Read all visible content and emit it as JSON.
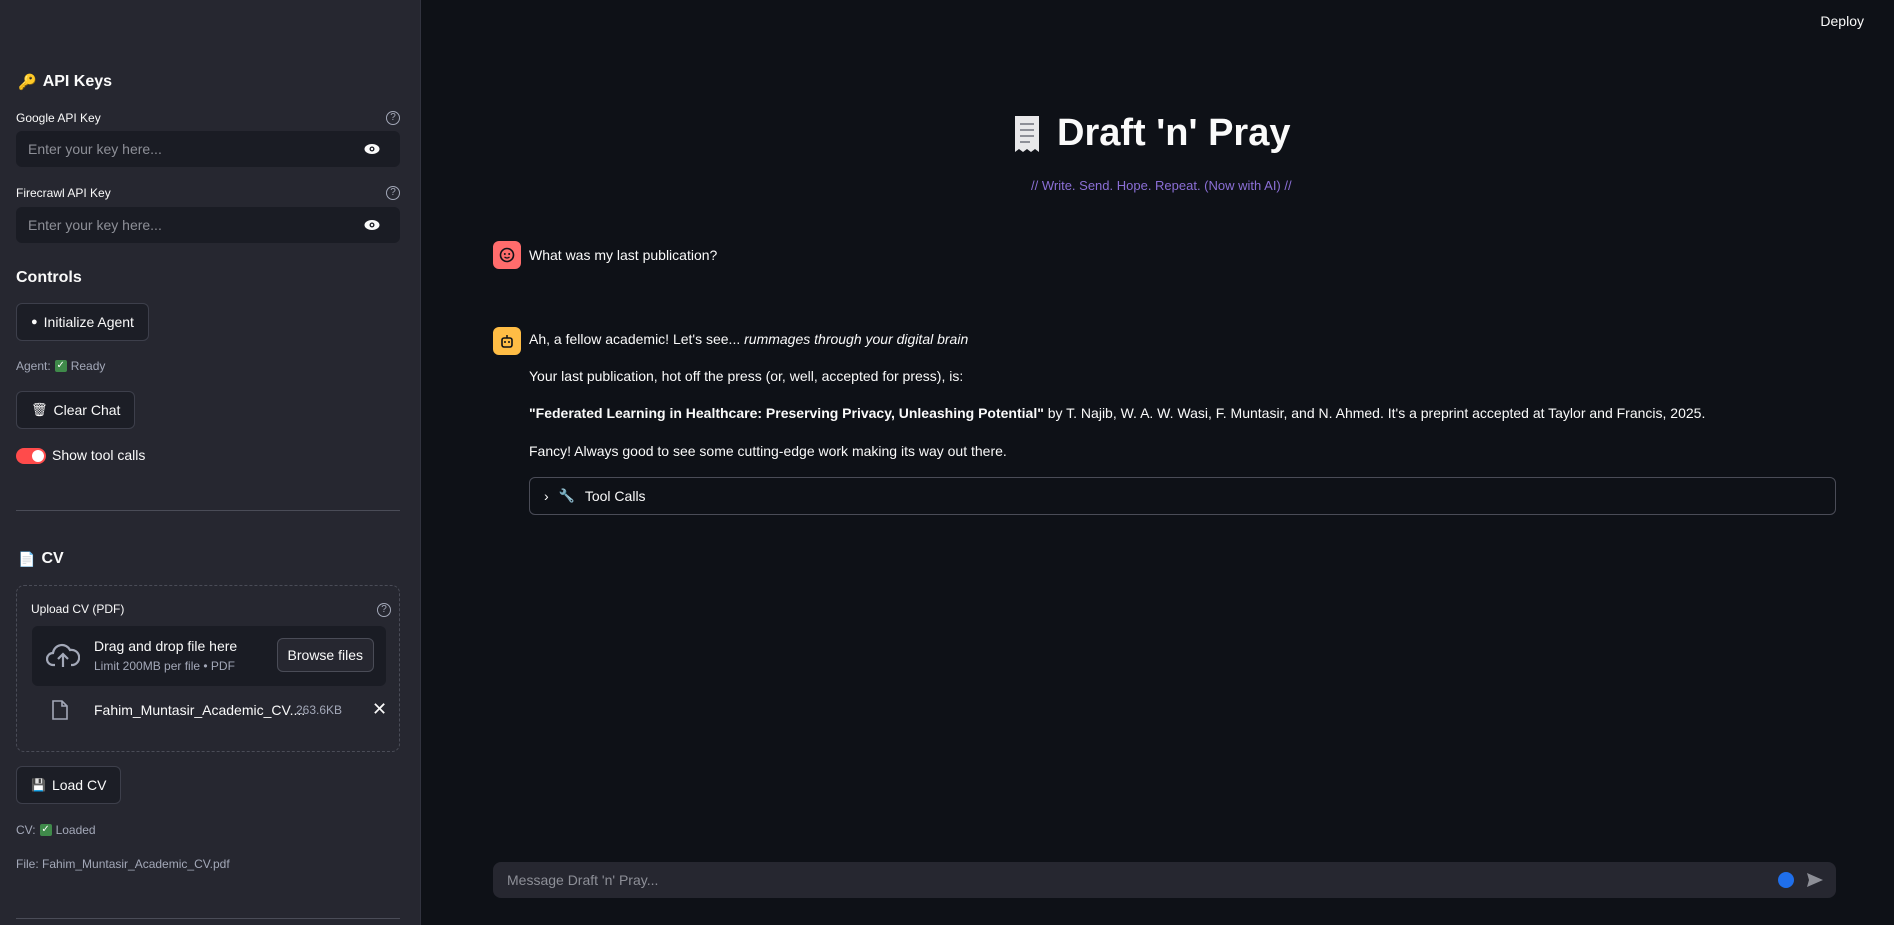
{
  "header": {
    "deploy_label": "Deploy"
  },
  "sidebar": {
    "api_keys": {
      "heading": "API Keys",
      "google_label": "Google API Key",
      "google_placeholder": "Enter your key here...",
      "firecrawl_label": "Firecrawl API Key",
      "firecrawl_placeholder": "Enter your key here..."
    },
    "controls": {
      "heading": "Controls",
      "init_label": "Initialize Agent",
      "agent_status_label": "Agent:",
      "agent_status_value": "Ready",
      "clear_label": "Clear Chat",
      "toggle_label": "Show tool calls",
      "toggle_on": true
    },
    "cv": {
      "heading": "CV",
      "upload_label": "Upload CV (PDF)",
      "drop_title": "Drag and drop file here",
      "drop_sub": "Limit 200MB per file • PDF",
      "browse_label": "Browse files",
      "file_name": "Fahim_Muntasir_Academic_CV....",
      "file_size": "263.6KB",
      "load_label": "Load CV",
      "cv_status_label": "CV:",
      "cv_status_value": "Loaded",
      "file_line": "File: Fahim_Muntasir_Academic_CV.pdf"
    }
  },
  "main": {
    "title": "Draft 'n' Pray",
    "subtitle": "// Write. Send. Hope. Repeat. (Now with AI) //",
    "messages": {
      "user_text": "What was my last publication?",
      "bot_line1_plain": "Ah, a fellow academic! Let's see... ",
      "bot_line1_italic": "rummages through your digital brain",
      "bot_line2": "Your last publication, hot off the press (or, well, accepted for press), is:",
      "bot_line3_bold": "\"Federated Learning in Healthcare: Preserving Privacy, Unleashing Potential\"",
      "bot_line3_rest": " by T. Najib, W. A. W. Wasi, F. Muntasir, and N. Ahmed. It's a preprint accepted at Taylor and Francis, 2025.",
      "bot_line4": "Fancy! Always good to see some cutting-edge work making its way out there.",
      "tool_calls_label": "Tool Calls"
    },
    "chat_placeholder": "Message Draft 'n' Pray..."
  },
  "colors": {
    "accent": "#ff4b4b",
    "subtitle": "#8b6fd6",
    "user_avatar": "#ff6c6c",
    "bot_avatar": "#ffbd45"
  }
}
